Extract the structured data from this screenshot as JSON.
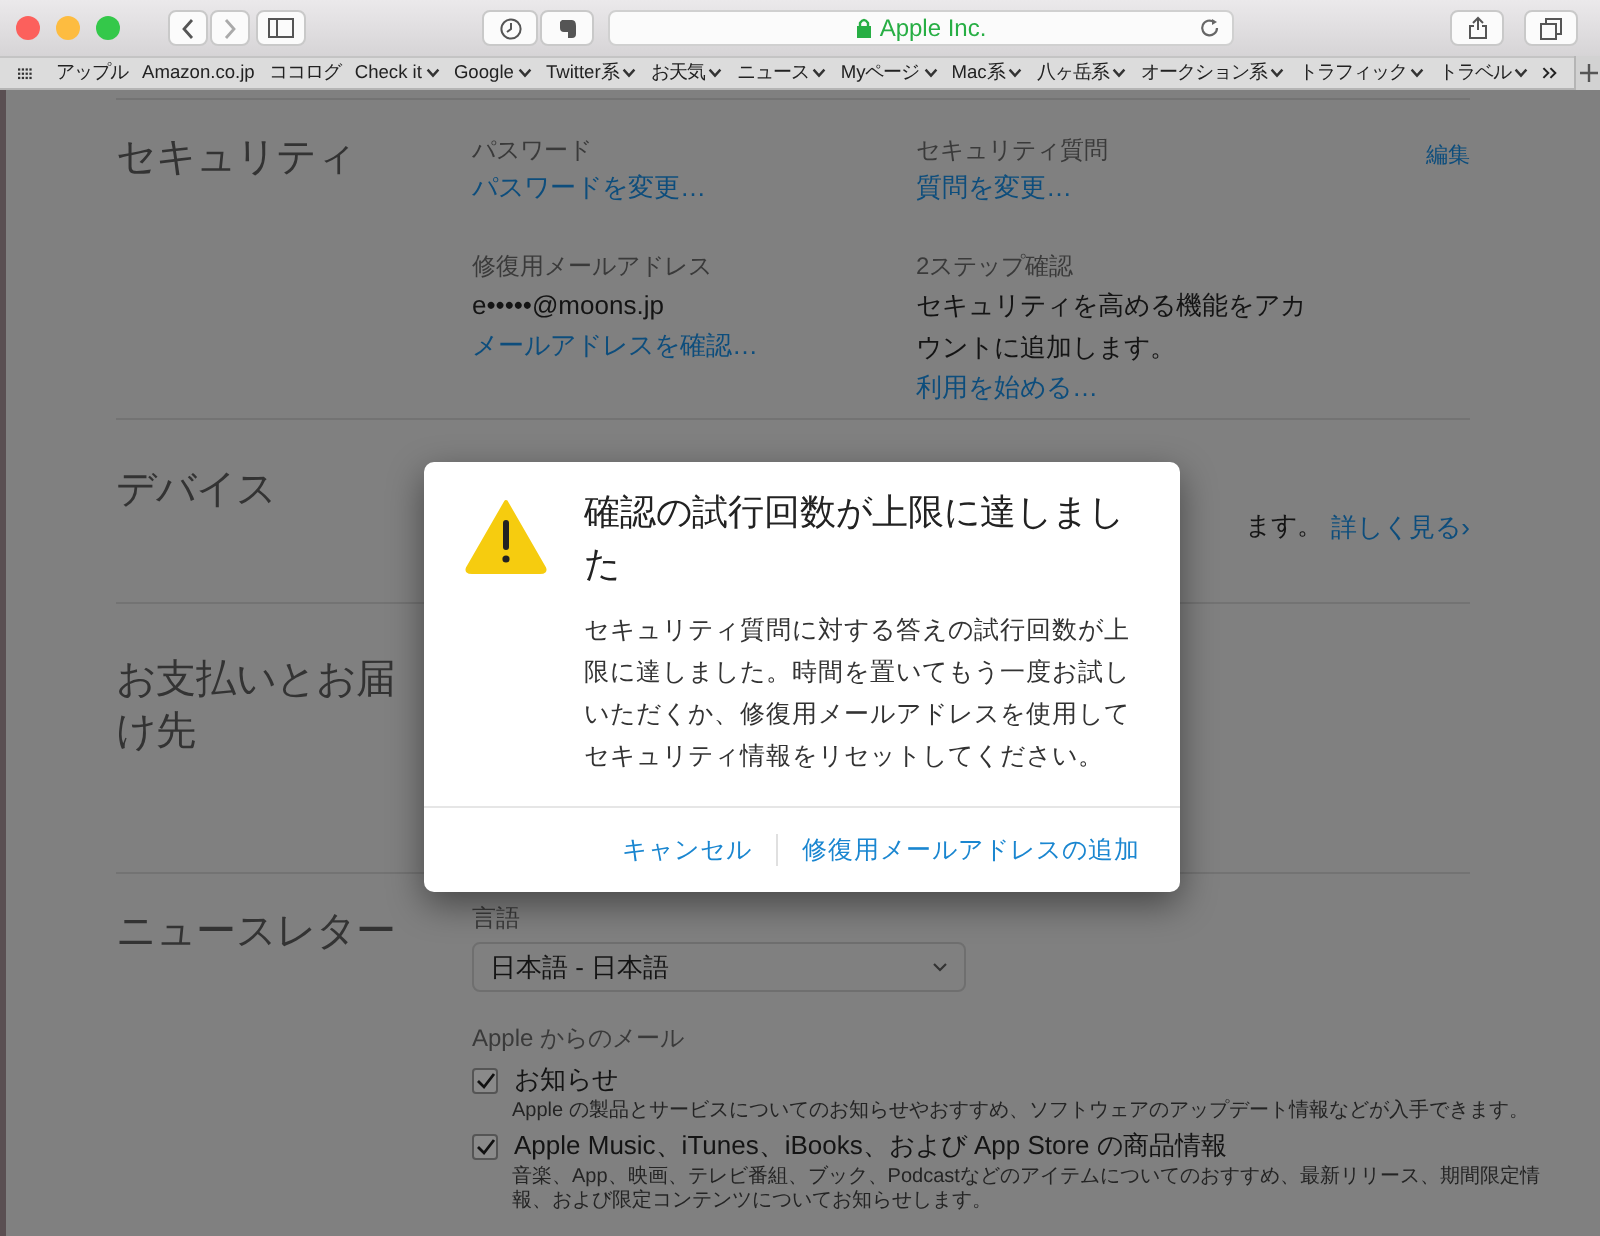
{
  "browser": {
    "address": "Apple Inc.",
    "secure": true
  },
  "bookmarks": [
    {
      "label": "アップル",
      "menu": false
    },
    {
      "label": "Amazon.co.jp",
      "menu": false
    },
    {
      "label": "ココログ",
      "menu": false
    },
    {
      "label": "Check it",
      "menu": true
    },
    {
      "label": "Google",
      "menu": true
    },
    {
      "label": "Twitter系",
      "menu": true
    },
    {
      "label": "お天気",
      "menu": true
    },
    {
      "label": "ニュース",
      "menu": true
    },
    {
      "label": "Myページ",
      "menu": true
    },
    {
      "label": "Mac系",
      "menu": true
    },
    {
      "label": "八ヶ岳系",
      "menu": true
    },
    {
      "label": "オークション系",
      "menu": true
    },
    {
      "label": "トラフィック",
      "menu": true
    },
    {
      "label": "トラベル",
      "menu": true
    }
  ],
  "security": {
    "title": "セキュリティ",
    "edit": "編集",
    "items": [
      {
        "label": "パスワード",
        "link": "パスワードを変更…"
      },
      {
        "label": "セキュリティ質問",
        "link": "質問を変更…"
      },
      {
        "label": "修復用メールアドレス",
        "text": "e•••••@moons.jp",
        "link": "メールアドレスを確認…"
      },
      {
        "label": "2ステップ確認",
        "text": "セキュリティを高める機能をアカウントに追加します。",
        "link": "利用を始める…"
      }
    ]
  },
  "devices": {
    "title": "デバイス",
    "text": "ます。",
    "link": "詳しく見る›"
  },
  "payment": {
    "title": "お支払いとお届け先"
  },
  "newsletter": {
    "title": "ニュースレター",
    "language_label": "言語",
    "language": "日本語 - 日本語",
    "mail_heading": "Apple からのメール",
    "options": [
      {
        "label": "お知らせ",
        "description": "Apple の製品とサービスについてのお知らせやおすすめ、ソフトウェアのアップデート情報などが入手できます。",
        "checked": true
      },
      {
        "label": "Apple Music、iTunes、iBooks、および App Store の商品情報",
        "description": "音楽、App、映画、テレビ番組、ブック、Podcastなどのアイテムについてのおすすめ、最新リリース、期間限定情報、および限定コンテンツについてお知らせします。",
        "checked": true
      }
    ]
  },
  "dialog": {
    "title": "確認の試行回数が上限に達しました",
    "message": "セキュリティ質問に対する答えの試行回数が上限に達しました。時間を置いてもう一度お試しいただくか、修復用メールアドレスを使用してセキュリティ情報をリセットしてください。",
    "buttons": [
      "キャンセル",
      "修復用メールアドレスの追加"
    ]
  }
}
